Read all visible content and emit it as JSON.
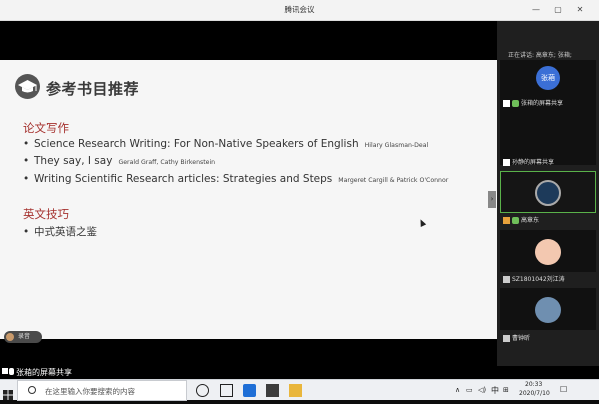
{
  "window": {
    "title": "腾讯会议"
  },
  "slide": {
    "title": "参考书目推荐",
    "sections": [
      {
        "heading": "论文写作",
        "items": [
          {
            "text": "Science Research Writing: For Non-Native Speakers of English",
            "author": "Hilary Glasman-Deal"
          },
          {
            "text": "They say, I say",
            "author": "Gerald Graff, Cathy Birkenstein"
          },
          {
            "text": "Writing Scientific Research articles: Strategies and Steps",
            "author": "Margeret Cargill & Patrick O'Connor"
          }
        ]
      },
      {
        "heading": "英文技巧",
        "items": [
          {
            "text": "中式英语之鉴",
            "author": ""
          }
        ]
      }
    ]
  },
  "speaking": "正在讲话: 高章东; 张葙;",
  "participants": [
    {
      "name": "张葙的屏幕共享",
      "avatar_text": "张葙"
    },
    {
      "name": "孙静的屏幕共享",
      "avatar_text": ""
    },
    {
      "name": "高章东",
      "avatar_text": ""
    },
    {
      "name": "SZ1801042刘江涛",
      "avatar_text": ""
    },
    {
      "name": "曹钟昕",
      "avatar_text": ""
    }
  ],
  "bottom_badge": "录音",
  "share_status": "张葙的屏幕共享",
  "taskbar": {
    "search_placeholder": "在这里输入你要搜索的内容",
    "ime": "中",
    "time": "20:33",
    "date": "2020/7/10"
  },
  "colors": {
    "accent_heading": "#a5312e",
    "avatar_blue": "#3b6fd6",
    "sharing_bar": "#000000"
  }
}
